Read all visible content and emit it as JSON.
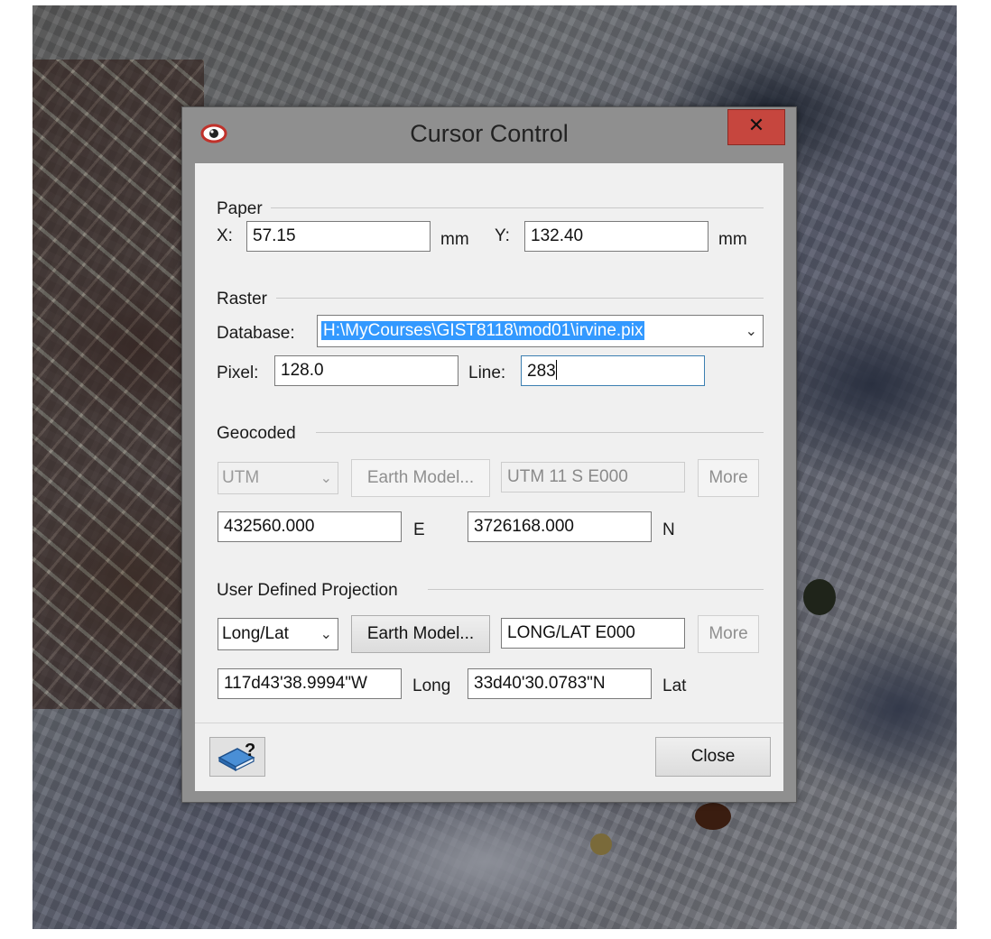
{
  "window": {
    "title": "Cursor Control",
    "close_glyph": "✕",
    "app_icon": "eye-icon"
  },
  "paper": {
    "title": "Paper",
    "x_label": "X:",
    "x_value": "57.15",
    "x_unit": "mm",
    "y_label": "Y:",
    "y_value": "132.40",
    "y_unit": "mm"
  },
  "raster": {
    "title": "Raster",
    "database_label": "Database:",
    "database_value": "H:\\MyCourses\\GIST8118\\mod01\\irvine.pix",
    "pixel_label": "Pixel:",
    "pixel_value": "128.0",
    "line_label": "Line:",
    "line_value": "283"
  },
  "geocoded": {
    "title": "Geocoded",
    "projection": "UTM",
    "earth_model_label": "Earth Model...",
    "projection_string": "UTM    11 S E000",
    "more_label": "More",
    "easting_value": "432560.000",
    "easting_label": "E",
    "northing_value": "3726168.000",
    "northing_label": "N"
  },
  "user_projection": {
    "title": "User Defined Projection",
    "projection": "Long/Lat",
    "earth_model_label": "Earth Model...",
    "projection_string": "LONG/LAT    E000",
    "more_label": "More",
    "long_value": "117d43'38.9994\"W",
    "long_label": "Long",
    "lat_value": "33d40'30.0783\"N",
    "lat_label": "Lat"
  },
  "footer": {
    "help_icon": "help-book-icon",
    "close_label": "Close"
  },
  "colors": {
    "close_button": "#c6463e",
    "selection": "#3399ff",
    "dialog_bg": "#f0f0f0",
    "dialog_frame": "#8f8f8f"
  }
}
